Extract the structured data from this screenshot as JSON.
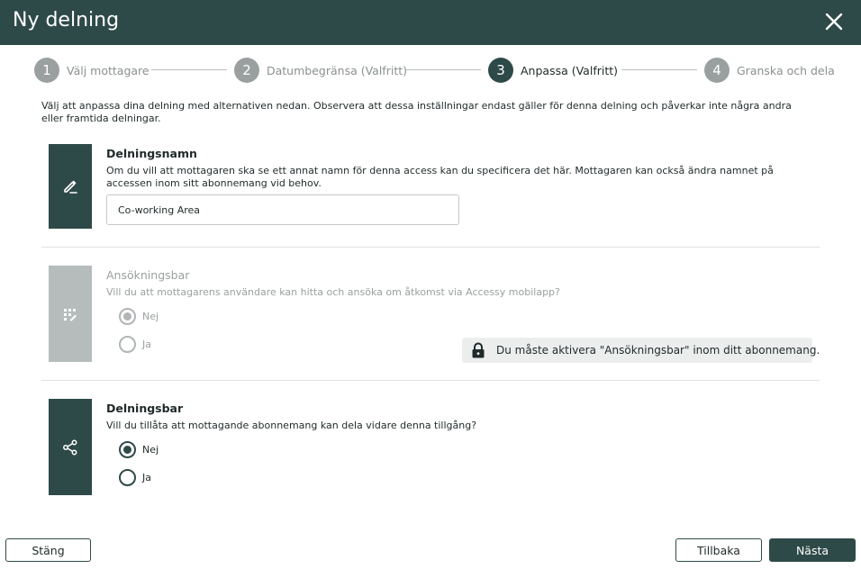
{
  "dialog": {
    "title": "Ny delning"
  },
  "stepper": {
    "steps": [
      {
        "number": "1",
        "label": "Välj mottagare"
      },
      {
        "number": "2",
        "label": "Datumbegränsa (Valfritt)"
      },
      {
        "number": "3",
        "label": "Anpassa (Valfritt)"
      },
      {
        "number": "4",
        "label": "Granska och dela"
      }
    ],
    "active_step": "3"
  },
  "intro": "Välj att anpassa dina delning med alternativen nedan. Observera att dessa inställningar endast gäller för denna delning och påverkar inte några andra eller framtida delningar.",
  "share_name": {
    "title": "Delningsnamn",
    "description": "Om du vill att mottagaren ska se ett annat namn för denna access kan du specificera det här. Mottagaren kan också ändra namnet på accessen inom sitt abonnemang vid behov.",
    "value": "Co-working Area",
    "icon": "edit-pen-icon"
  },
  "applicable": {
    "title": "Ansökningsbar",
    "description": "Vill du att mottagarens användare kan hitta och ansöka om åtkomst via Accessy mobilapp?",
    "options": [
      {
        "label": "Nej",
        "selected": true
      },
      {
        "label": "Ja",
        "selected": false
      }
    ],
    "disabled": true,
    "notice": "Du måste aktivera \"Ansökningsbar\" inom ditt abonnemang.",
    "icon": "application-icon"
  },
  "shareable": {
    "title": "Delningsbar",
    "description": "Vill du tillåta att mottagande abonnemang kan dela vidare denna tillgång?",
    "options": [
      {
        "label": "Nej",
        "selected": true
      },
      {
        "label": "Ja",
        "selected": false
      }
    ],
    "icon": "share-icon"
  },
  "footer": {
    "close_label": "Stäng",
    "back_label": "Tillbaka",
    "next_label": "Nästa"
  },
  "colors": {
    "primary": "#2e4a48",
    "disabled": "#b6bcbc",
    "step_inactive": "#9aa0a0"
  }
}
